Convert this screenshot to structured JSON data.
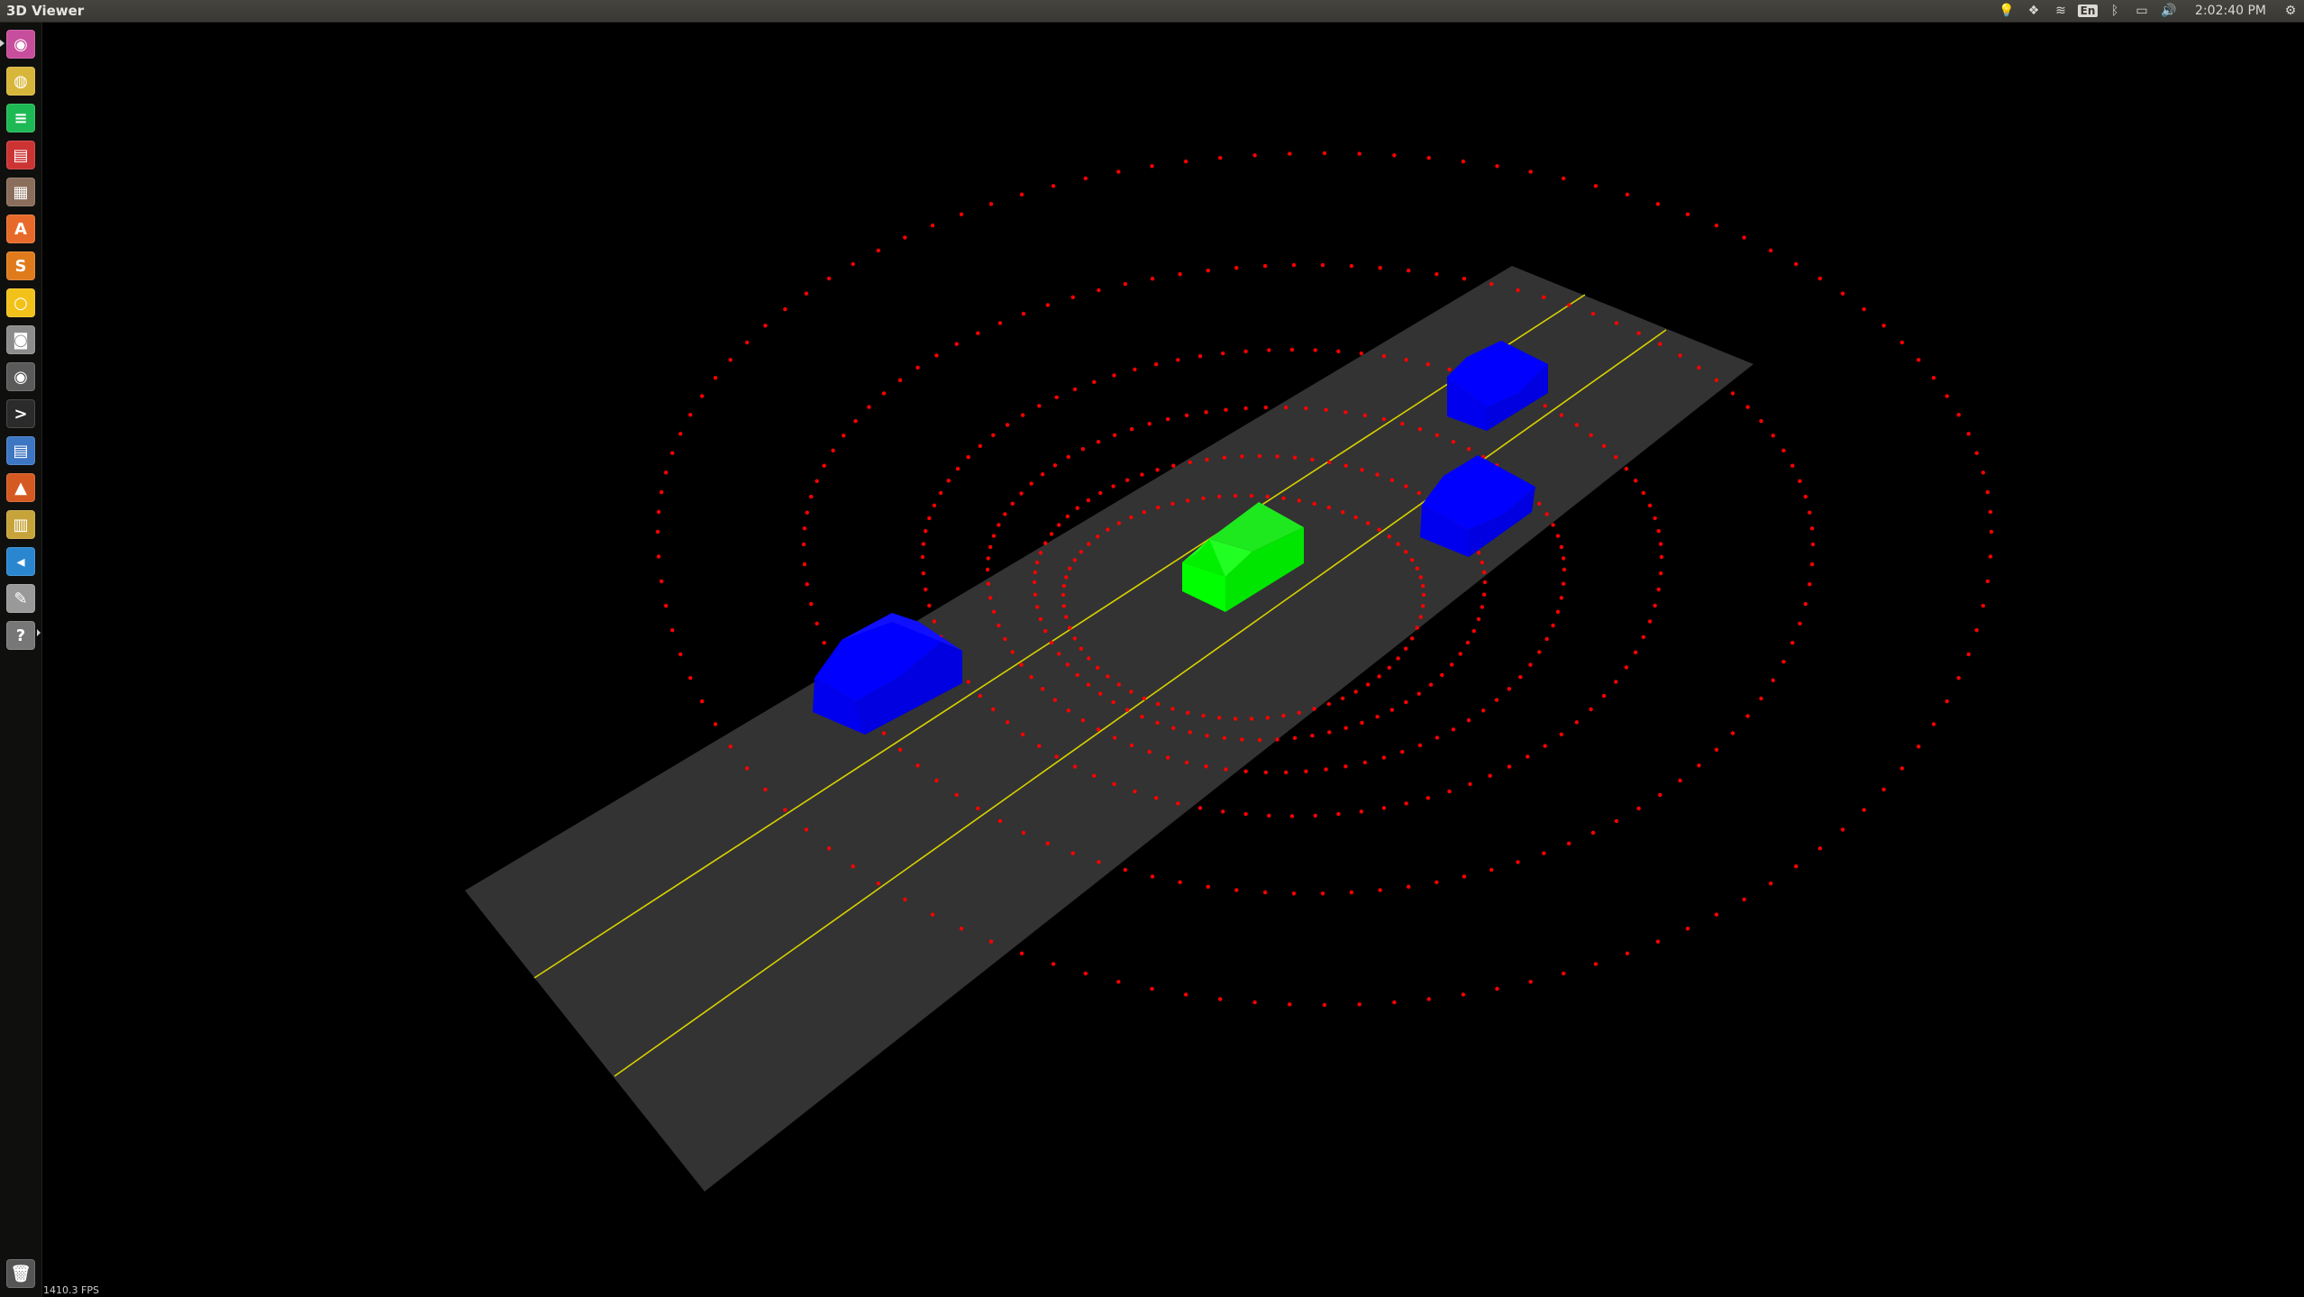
{
  "window": {
    "title": "3D Viewer"
  },
  "panel": {
    "indicators": [
      {
        "icon": "lightbulb-icon",
        "glyph": "💡"
      },
      {
        "icon": "dropbox-icon",
        "glyph": "❖"
      },
      {
        "icon": "wifi-icon",
        "glyph": "≋"
      },
      {
        "icon": "keyboard-layout-icon",
        "label": "En"
      },
      {
        "icon": "bluetooth-icon",
        "glyph": "ᛒ"
      },
      {
        "icon": "battery-icon",
        "glyph": "▭"
      },
      {
        "icon": "volume-icon",
        "glyph": "🔊"
      }
    ],
    "clock": "2:02:40 PM",
    "settings_icon": "gear-icon",
    "settings_glyph": "⚙"
  },
  "launcher": {
    "items": [
      {
        "name": "ubuntu-dash-icon",
        "color": "#c74e9c",
        "glyph": "◉"
      },
      {
        "name": "chrome-icon",
        "color": "#d8b63b",
        "glyph": "◍"
      },
      {
        "name": "spotify-icon",
        "color": "#1db954",
        "glyph": "≡"
      },
      {
        "name": "presentation-icon",
        "color": "#c33",
        "glyph": "▤"
      },
      {
        "name": "files-icon",
        "color": "#8a6d5a",
        "glyph": "▦"
      },
      {
        "name": "software-center-icon",
        "color": "#e86a2a",
        "glyph": "A"
      },
      {
        "name": "sublime-text-icon",
        "color": "#e07b1c",
        "glyph": "S"
      },
      {
        "name": "lightbulb-app-icon",
        "color": "#f2c21a",
        "glyph": "○"
      },
      {
        "name": "camera-icon",
        "color": "#8c8c8c",
        "glyph": "◙"
      },
      {
        "name": "webcam-icon",
        "color": "#5a5a5a",
        "glyph": "◉"
      },
      {
        "name": "terminal-icon",
        "color": "#2b2b2b",
        "glyph": ">"
      },
      {
        "name": "text-document-icon",
        "color": "#3d76c2",
        "glyph": "▤"
      },
      {
        "name": "matlab-icon",
        "color": "#d45a22",
        "glyph": "▲"
      },
      {
        "name": "system-monitor-icon",
        "color": "#c7a43a",
        "glyph": "▥"
      },
      {
        "name": "vscode-icon",
        "color": "#2a87cf",
        "glyph": "◂"
      },
      {
        "name": "text-editor-icon",
        "color": "#999",
        "glyph": "✎"
      },
      {
        "name": "unknown-app-icon",
        "color": "#777",
        "glyph": "?"
      }
    ],
    "trash_icon": "trash-icon",
    "trash_glyph": "🗑"
  },
  "viewer": {
    "fps_label": "1410.3 FPS",
    "scene_objects": {
      "road_color": "#333333",
      "lane_line_color": "#d8d200",
      "ego_vehicle_color": "#00ff00",
      "other_vehicle_color": "#0000ff",
      "lidar_point_color": "#ff0000"
    }
  }
}
